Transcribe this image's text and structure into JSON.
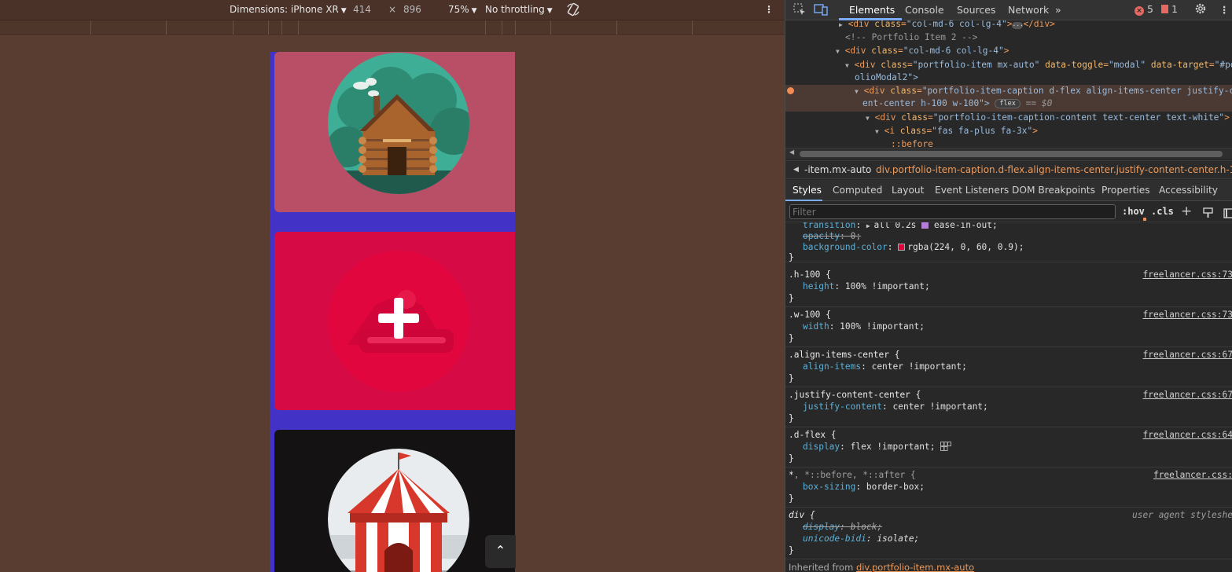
{
  "device_toolbar": {
    "dimensions_label": "Dimensions: iPhone XR",
    "width": "414",
    "times": "×",
    "height": "896",
    "zoom": "75%",
    "throttling": "No throttling",
    "more_icon": "⋮"
  },
  "portfolio": {
    "cards": [
      {
        "name": "Cabin",
        "bg": "#b94f66"
      },
      {
        "name": "Cake",
        "bg": "#d1104a",
        "overlay": "rgba(224, 0, 60, 0.9)"
      },
      {
        "name": "Circus",
        "bg": "#141212"
      }
    ],
    "scroll_top_icon": "⌃"
  },
  "devtools": {
    "tabs": [
      "Elements",
      "Console",
      "Sources",
      "Network"
    ],
    "more_tabs": "»",
    "errors_count": "5",
    "issues_count": "1",
    "dom_lines": {
      "l1_tag_open": "<div ",
      "l1_attr": "class",
      "l1_eq": "=",
      "l1_val": "\"col-md-6 col-lg-4\"",
      "l1_close": "></div>",
      "l2_comment": "<!-- Portfolio Item 2 -->",
      "l3_tag_open": "<div ",
      "l3_attr": "class",
      "l3_val": "\"col-md-6 col-lg-4\"",
      "l3_close": ">",
      "l4_tag": "<div ",
      "l4_attr1": "class",
      "l4_val1": "\"portfolio-item mx-auto\"",
      "l4_attr2": " data-toggle",
      "l4_val2": "\"modal\"",
      "l4_attr3": " data-target",
      "l4_val3": "\"#por",
      "l4_wrap": "olioModal2\">",
      "l5_tag": "<div ",
      "l5_attr": "class",
      "l5_val": "\"portfolio-item-caption d-flex align-items-center justify-co",
      "l5_wrap": "ent-center h-100 w-100\">",
      "l5_badge": "flex",
      "l5_eq0": "== $0",
      "l6_tag": "<div ",
      "l6_attr": "class",
      "l6_val": "\"portfolio-item-caption-content text-center text-white\"",
      "l6_close": ">",
      "l7_tag": "<i ",
      "l7_attr": "class",
      "l7_val": "\"fas fa-plus fa-3x\"",
      "l7_close": ">",
      "l8_pseudo": "::before"
    },
    "breadcrumbs": {
      "first": "-item.mx-auto",
      "second": "div.portfolio-item-caption.d-flex.align-items-center.justify-content-center.h-100.w-100"
    },
    "subtabs": [
      "Styles",
      "Computed",
      "Layout",
      "Event Listeners",
      "DOM Breakpoints",
      "Properties",
      "Accessibility"
    ],
    "filter_placeholder": "Filter",
    "hov": ":hov",
    "cls": ".cls",
    "styles": {
      "r0_l1_prop": "transition",
      "r0_l1_val_a": "all 0.2s",
      "r0_l1_val_b": "ease-in-out",
      "r0_l1_end": ";",
      "r0_l2_prop": "opacity",
      "r0_l2_val": "0",
      "r0_l3_prop": "background-color",
      "r0_l3_val": "rgba(224, 0, 60, 0.9)",
      "r0_swatch": "#e0003c",
      "r1_sel": ".h-100 {",
      "r1_src": "freelancer.css:73",
      "r1_prop": "height",
      "r1_val": "100% !important",
      "r2_sel": ".w-100 {",
      "r2_src": "freelancer.css:73",
      "r2_prop": "width",
      "r2_val": "100% !important",
      "r3_sel": ".align-items-center {",
      "r3_src": "freelancer.css:67",
      "r3_prop": "align-items",
      "r3_val": "center !important",
      "r4_sel": ".justify-content-center {",
      "r4_src": "freelancer.css:67",
      "r4_prop": "justify-content",
      "r4_val": "center !important",
      "r5_sel": ".d-flex {",
      "r5_src": "freelancer.css:64",
      "r5_prop": "display",
      "r5_val": "flex !important",
      "r6_sel_a": "*",
      "r6_sel_b": ", *::before, *::after {",
      "r6_src": "freelancer.css:",
      "r6_prop": "box-sizing",
      "r6_val": "border-box",
      "r7_sel": "div {",
      "r7_src": "user agent styleshe",
      "r7_prop1": "display",
      "r7_val1": "block",
      "r7_prop2": "unicode-bidi",
      "r7_val2": "isolate",
      "close": "}",
      "inherited_label": "Inherited from ",
      "inherited_link": "div.portfolio-item.mx-auto"
    }
  }
}
